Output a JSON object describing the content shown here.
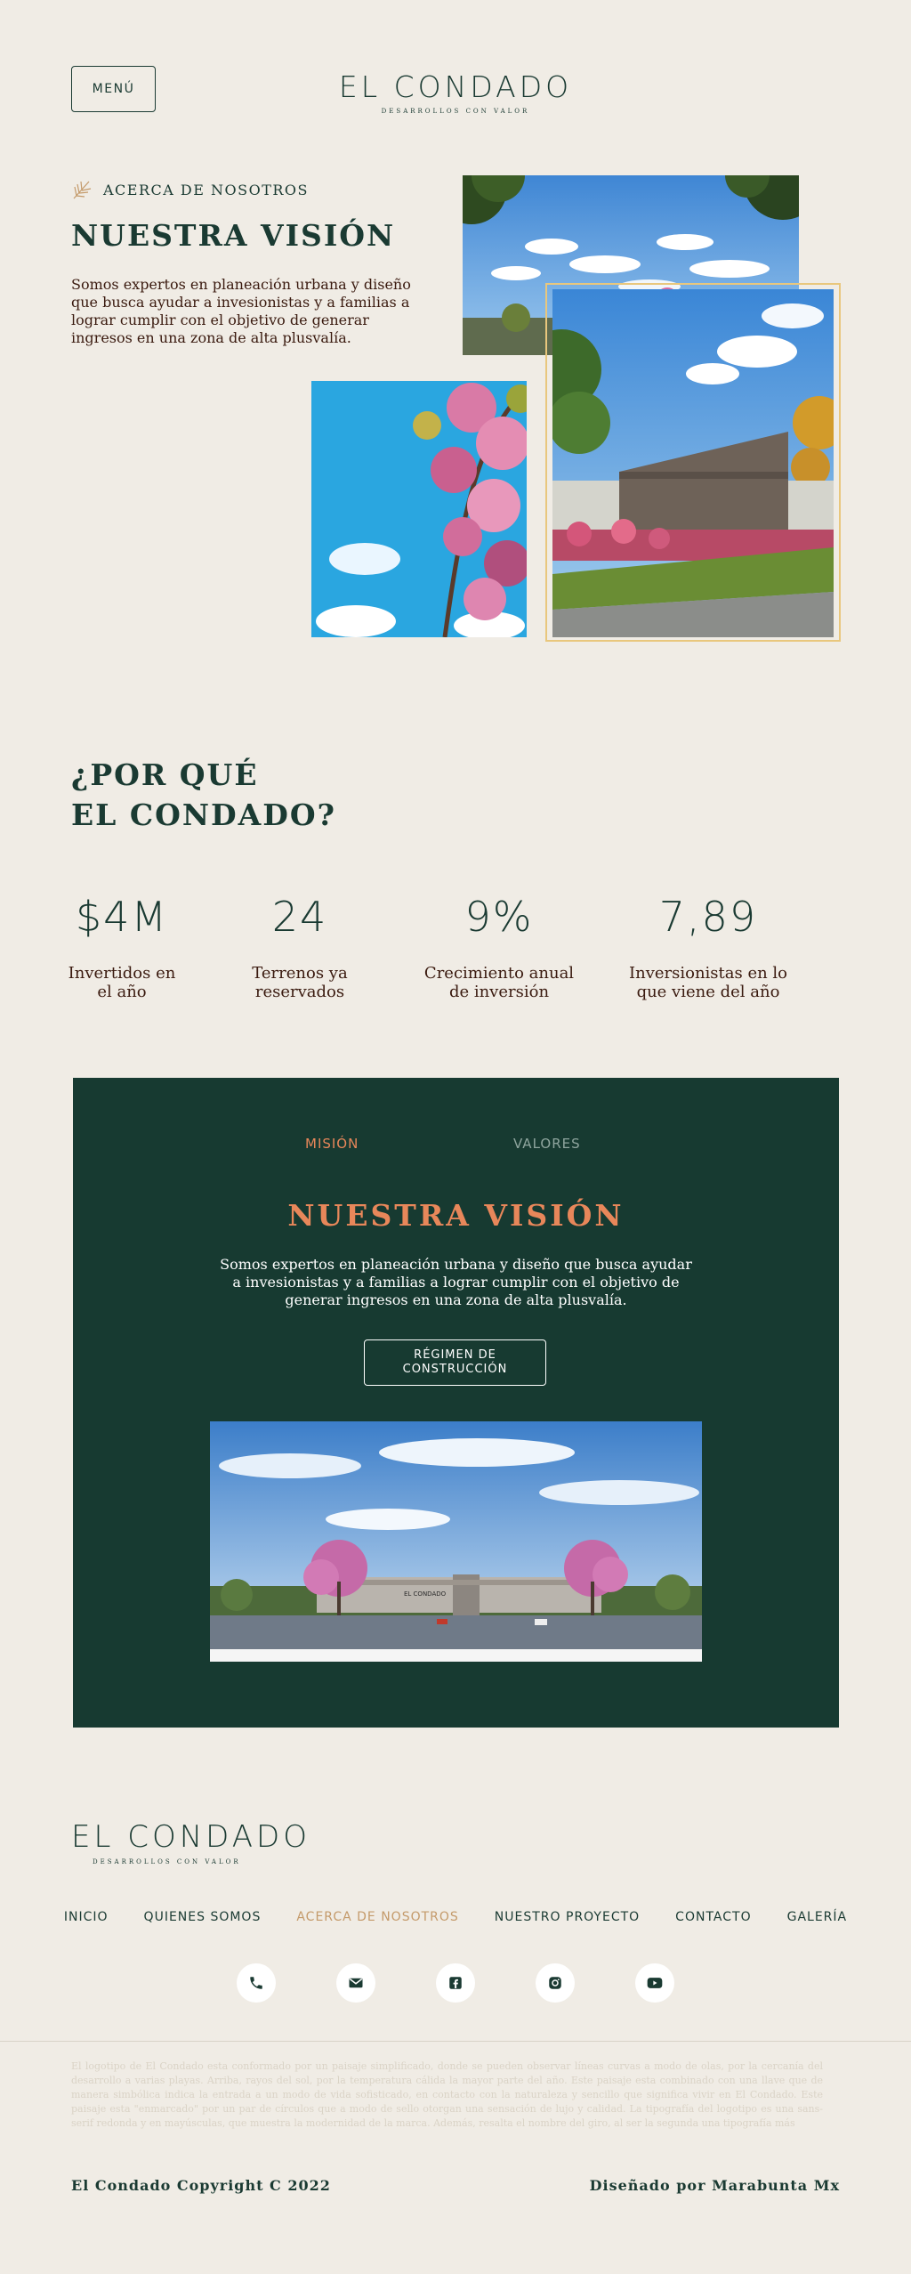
{
  "header": {
    "menu_label": "MENÚ",
    "logo_main": "EL CONDADO",
    "logo_sub": "DESARROLLOS CON VALOR"
  },
  "about": {
    "eyebrow": "ACERCA DE NOSOTROS",
    "title": "NUESTRA VISIÓN",
    "text": "Somos expertos en planeación urbana y diseño que busca ayudar a invesionistas y a familias a lograr cumplir con el objetivo de generar ingresos en una zona de alta plusvalía."
  },
  "why": {
    "title_line1": "¿POR QUÉ",
    "title_line2": "EL CONDADO?",
    "stats": [
      {
        "value": "$4M",
        "label_line1": "Invertidos en",
        "label_line2": "el año"
      },
      {
        "value": "24",
        "label_line1": "Terrenos ya",
        "label_line2": "reservados"
      },
      {
        "value": "9%",
        "label_line1": "Crecimiento anual",
        "label_line2": "de inversión"
      },
      {
        "value": "7,89",
        "label_line1": "Inversionistas en lo",
        "label_line2": "que viene del año"
      }
    ]
  },
  "panel": {
    "tabs": [
      {
        "label": "MISIÓN",
        "active": true
      },
      {
        "label": "VALORES",
        "active": false
      }
    ],
    "title": "NUESTRA VISIÓN",
    "text": "Somos expertos en planeación urbana y diseño que busca ayudar a invesionistas y a familias a lograr cumplir con el objetivo de generar ingresos en una zona de alta plusvalía.",
    "button_line1": "RÉGIMEN DE",
    "button_line2": "CONSTRUCCIÓN",
    "gate_sign": "EL CONDADO"
  },
  "footer": {
    "logo_main": "EL CONDADO",
    "logo_sub": "DESARROLLOS CON VALOR",
    "nav": [
      "INICIO",
      "QUIENES SOMOS",
      "ACERCA DE NOSOTROS",
      "NUESTRO PROYECTO",
      "CONTACTO",
      "GALERÍA"
    ],
    "nav_active_index": 2,
    "socials": [
      "phone-icon",
      "mail-icon",
      "facebook-icon",
      "instagram-icon",
      "youtube-icon"
    ],
    "legal": "El logotipo de El Condado esta conformado por un paisaje simplificado, donde se pueden observar líneas curvas a modo de olas, por la cercanía del desarrollo a varias playas. Arriba, rayos del sol, por la temperatura cálida la mayor parte del año. Este paisaje esta combinado con una llave que de manera simbólica indica la entrada a un modo de vida sofisticado, en contacto con la naturaleza y sencillo que significa vivir en El Condado. Este paisaje esta \"enmarcado\" por un par de círculos que a modo de sello otorgan una sensación de lujo y calidad. La tipografía del logotipo es una sans-serif redonda y en mayúsculas, que muestra la modernidad de la marca. Además, resalta el nombre del giro, al ser la segunda una tipografía más",
    "copyright": "El Condado Copyright C 2022",
    "designer": "Diseñado por Marabunta Mx"
  },
  "colors": {
    "background": "#f0ece5",
    "dark_green": "#173a31",
    "accent_orange": "#e8875a",
    "gold_frame": "#e9c77d",
    "nav_active": "#c49a6a"
  }
}
